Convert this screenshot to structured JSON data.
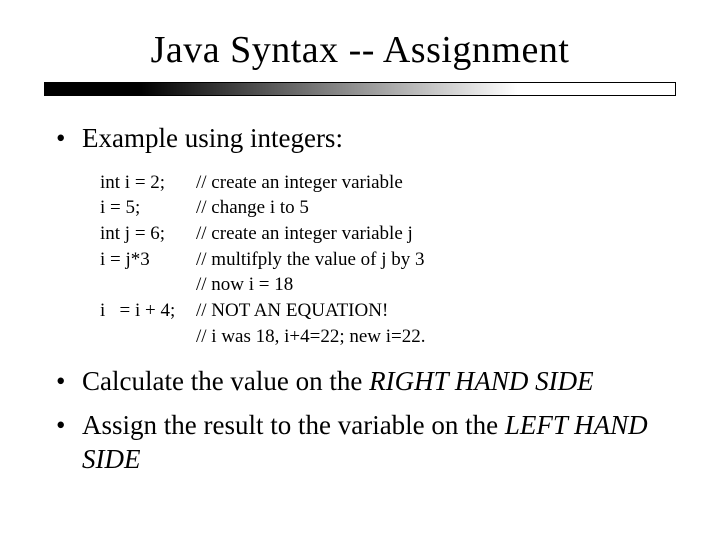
{
  "title": "Java Syntax -- Assignment",
  "bullets": {
    "example": "Example using integers:",
    "calc_pre": "Calculate the value on the ",
    "calc_em": "RIGHT HAND SIDE",
    "assign_pre": "Assign the result to the variable on the ",
    "assign_em": "LEFT HAND SIDE"
  },
  "code": [
    {
      "c1": "int i = 2;",
      "c2": "// create an integer variable"
    },
    {
      "c1": "i = 5;",
      "c2": "// change i to 5"
    },
    {
      "c1": "int j = 6;",
      "c2": "// create an integer variable j"
    },
    {
      "c1": "i = j*3",
      "c2": "// multifply the value of j by 3"
    },
    {
      "c1": "",
      "c2": "// now i = 18"
    },
    {
      "c1": "i   = i + 4;",
      "c2": "// NOT AN EQUATION!"
    },
    {
      "c1": "",
      "c2": "// i was 18, i+4=22; new i=22."
    }
  ]
}
